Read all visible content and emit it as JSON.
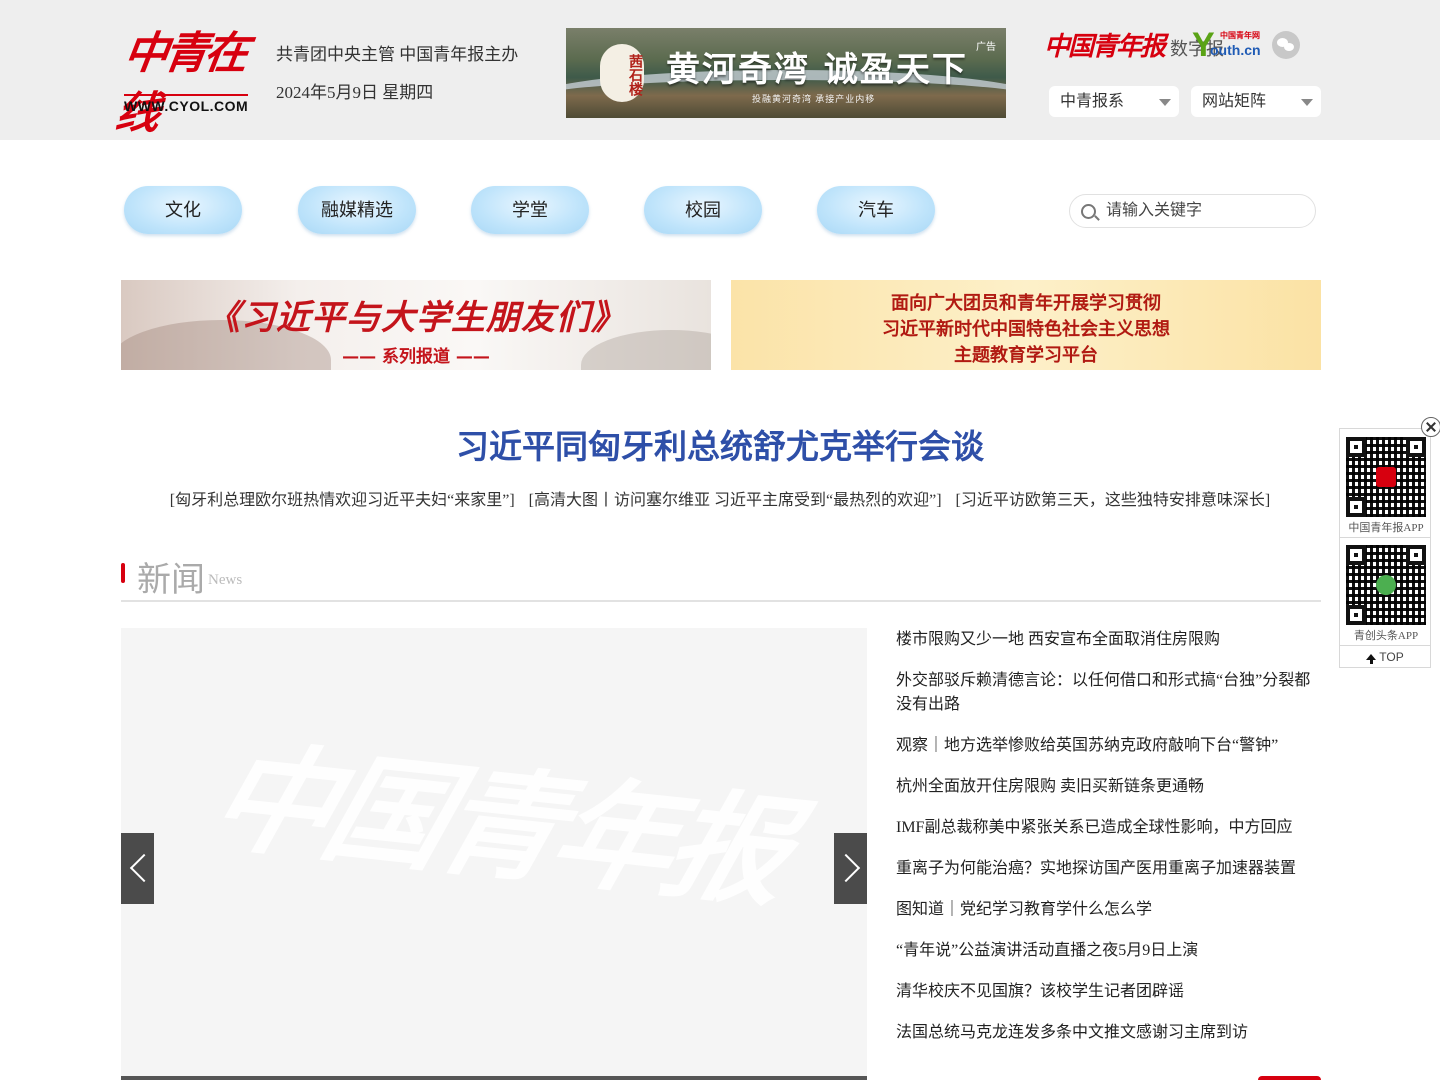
{
  "header": {
    "logo_text": "中青在线",
    "logo_url_text": "WWW.CYOL.COM",
    "tagline": "共青团中央主管 中国青年报主办",
    "date": "2024年5月9日 星期四",
    "ad": {
      "stamp": "茜石楼",
      "slogan": "黄河奇湾 诚盈天下",
      "subline": "投融黄河奇湾 承接产业内移",
      "tag": "广告"
    },
    "cyd_logo": "中国青年报",
    "cyd_digital": "数字报",
    "youth_logo_y": "Y",
    "youth_logo_outh": "outh.cn",
    "youth_logo_small": "中国青年网",
    "selects": [
      {
        "value": "中青报系"
      },
      {
        "value": "网站矩阵"
      }
    ]
  },
  "nav": {
    "items": [
      "文化",
      "融媒精选",
      "学堂",
      "校园",
      "汽车"
    ],
    "search_placeholder": "请输入关键字"
  },
  "banners": {
    "left_title": "《习近平与大学生朋友们》",
    "left_sub": "—— 系列报道 ——",
    "right_lines": [
      "面向广大团员和青年开展学习贯彻",
      "习近平新时代中国特色社会主义思想",
      "主题教育学习平台"
    ]
  },
  "headline": {
    "title": "习近平同匈牙利总统舒尤克举行会谈",
    "subs": [
      "[匈牙利总理欧尔班热情欢迎习近平夫妇“来家里”]",
      "[高清大图丨访问塞尔维亚 习近平主席受到“最热烈的欢迎”]",
      "[习近平访欧第三天，这些独特安排意味深长]"
    ]
  },
  "section": {
    "title": "新闻",
    "title_en": "News"
  },
  "slider": {
    "watermark": "中国青年报"
  },
  "news": [
    "楼市限购又少一地 西安宣布全面取消住房限购",
    "外交部驳斥赖清德言论：以任何借口和形式搞“台独”分裂都没有出路",
    "观察｜地方选举惨败给英国苏纳克政府敲响下台“警钟”",
    "杭州全面放开住房限购 卖旧买新链条更通畅",
    "IMF副总裁称美中紧张关系已造成全球性影响，中方回应",
    "重离子为何能治癌？实地探访国产医用重离子加速器装置",
    "图知道｜党纪学习教育学什么怎么学",
    "“青年说”公益演讲活动直播之夜5月9日上演",
    "清华校庆不见国旗？该校学生记者团辟谣",
    "法国总统马克龙连发多条中文推文感谢习主席到访"
  ],
  "float_panel": {
    "qr1_label": "中国青年报APP",
    "qr2_label": "青创头条APP",
    "top_label": "TOP"
  },
  "colors": {
    "brand_red": "#d7000f",
    "headline_blue": "#2e4fa8",
    "nav_pill": "#bfe4fb"
  }
}
